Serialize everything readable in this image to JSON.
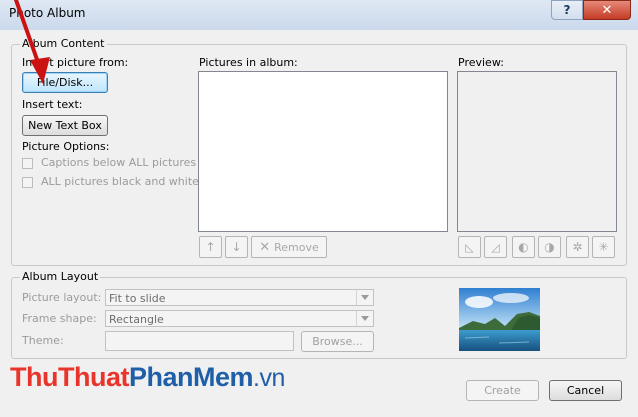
{
  "window": {
    "title": "Photo Album"
  },
  "album_content": {
    "group_label": "Album Content",
    "insert_picture_label": "Insert picture from:",
    "file_disk_button": "File/Disk...",
    "insert_text_label": "Insert text:",
    "new_text_box_button": "New Text Box",
    "picture_options_label": "Picture Options:",
    "captions_checkbox": {
      "label": "Captions below ALL pictures",
      "checked": false,
      "enabled": false
    },
    "bw_checkbox": {
      "label": "ALL pictures black and white",
      "checked": false,
      "enabled": false
    },
    "pictures_in_album_label": "Pictures in album:",
    "pictures": [],
    "remove_button": "Remove",
    "preview_label": "Preview:"
  },
  "album_layout": {
    "group_label": "Album Layout",
    "picture_layout_label": "Picture layout:",
    "picture_layout_value": "Fit to slide",
    "frame_shape_label": "Frame shape:",
    "frame_shape_value": "Rectangle",
    "theme_label": "Theme:",
    "theme_value": "",
    "browse_button": "Browse..."
  },
  "footer": {
    "create_button": "Create",
    "cancel_button": "Cancel"
  },
  "watermark": {
    "part1": "ThuThuat",
    "part2": "PhanMem",
    "part3": ".vn"
  },
  "icons": {
    "move-up": "arrow-up-icon",
    "move-down": "arrow-down-icon",
    "remove": "x-icon",
    "rotate-left": "rotate-left-icon",
    "rotate-right": "rotate-right-icon",
    "contrast-up": "contrast-up-icon",
    "contrast-down": "contrast-down-icon",
    "brightness-up": "brightness-up-icon",
    "brightness-down": "brightness-down-icon"
  },
  "colors": {
    "accent_arrow": "#cc1111",
    "watermark_red": "#e8342a",
    "watermark_blue": "#1f5fa8"
  }
}
